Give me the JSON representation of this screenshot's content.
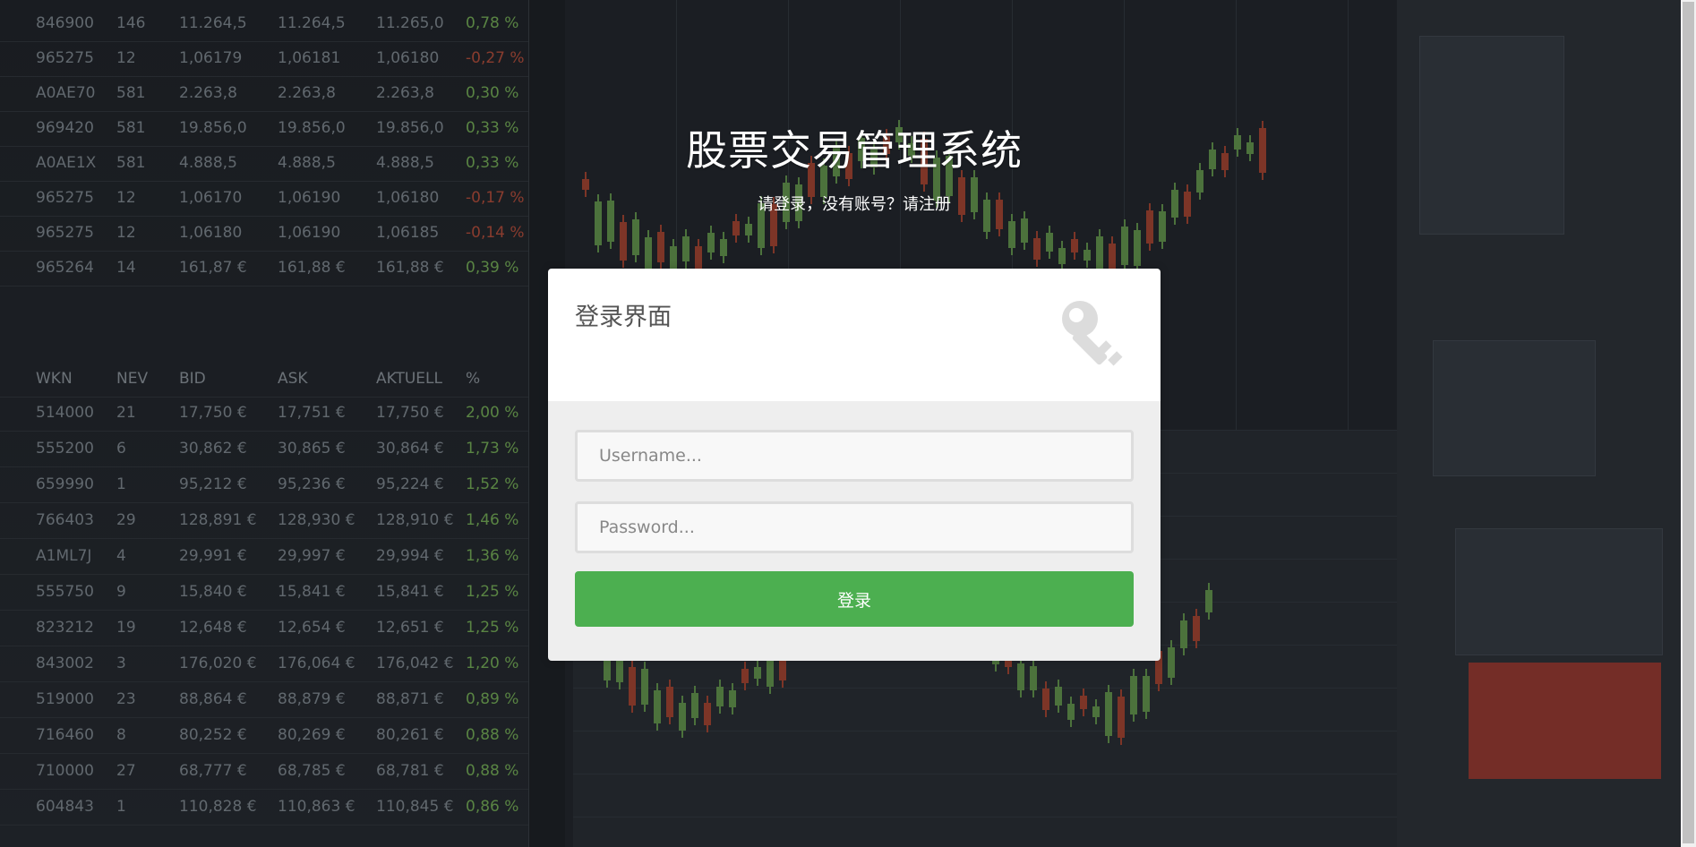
{
  "header": {
    "title": "股票交易管理系统",
    "prompt_text": "请登录，没有账号？",
    "register_link": "请注册"
  },
  "login_form": {
    "heading": "登录界面",
    "key_icon": "key-icon",
    "username_placeholder": "Username...",
    "password_placeholder": "Password...",
    "submit_label": "登录"
  },
  "colors": {
    "button": "#4caf50",
    "form_top": "#ffffff",
    "form_bottom": "#eeeeee"
  },
  "background": {
    "description_icon": "stock-trading-screens-image",
    "table_headers": [
      "WKN",
      "NEV",
      "BID",
      "ASK",
      "AKTUELL",
      "%"
    ],
    "top_rows": [
      [
        "846900",
        "146",
        "11.264,5",
        "11.264,5",
        "11.265,0",
        "0,78 %"
      ],
      [
        "965275",
        "12",
        "1,06179",
        "1,06181",
        "1,06180",
        "-0,27 %"
      ],
      [
        "A0AE70",
        "581",
        "2.263,8",
        "2.263,8",
        "2.263,8",
        "0,30 %"
      ],
      [
        "969420",
        "581",
        "19.856,0",
        "19.856,0",
        "19.856,0",
        "0,33 %"
      ],
      [
        "A0AE1X",
        "581",
        "4.888,5",
        "4.888,5",
        "4.888,5",
        "0,33 %"
      ],
      [
        "965275",
        "12",
        "1,06170",
        "1,06190",
        "1,06180",
        "-0,17 %"
      ],
      [
        "965275",
        "12",
        "1,06180",
        "1,06190",
        "1,06185",
        "-0,14 %"
      ],
      [
        "965264",
        "14",
        "161,87 €",
        "161,88 €",
        "161,88 €",
        "0,39 %"
      ]
    ],
    "bottom_rows": [
      [
        "514000",
        "21",
        "17,750 €",
        "17,751 €",
        "17,750 €",
        "2,00 %"
      ],
      [
        "555200",
        "6",
        "30,862 €",
        "30,865 €",
        "30,864 €",
        "1,73 %"
      ],
      [
        "659990",
        "1",
        "95,212 €",
        "95,236 €",
        "95,224 €",
        "1,52 %"
      ],
      [
        "766403",
        "29",
        "128,891 €",
        "128,930 €",
        "128,910 €",
        "1,46 %"
      ],
      [
        "A1ML7J",
        "4",
        "29,991 €",
        "29,997 €",
        "29,994 €",
        "1,36 %"
      ],
      [
        "555750",
        "9",
        "15,840 €",
        "15,841 €",
        "15,841 €",
        "1,25 %"
      ],
      [
        "823212",
        "19",
        "12,648 €",
        "12,654 €",
        "12,651 €",
        "1,25 %"
      ],
      [
        "843002",
        "3",
        "176,020 €",
        "176,064 €",
        "176,042 €",
        "1,20 %"
      ],
      [
        "519000",
        "23",
        "88,864 €",
        "88,879 €",
        "88,871 €",
        "0,89 %"
      ],
      [
        "716460",
        "8",
        "80,252 €",
        "80,269 €",
        "80,261 €",
        "0,88 %"
      ],
      [
        "710000",
        "27",
        "68,777 €",
        "68,785 €",
        "68,781 €",
        "0,88 %"
      ],
      [
        "604843",
        "1",
        "110,828 €",
        "110,863 €",
        "110,845 €",
        "0,86 %"
      ]
    ]
  }
}
